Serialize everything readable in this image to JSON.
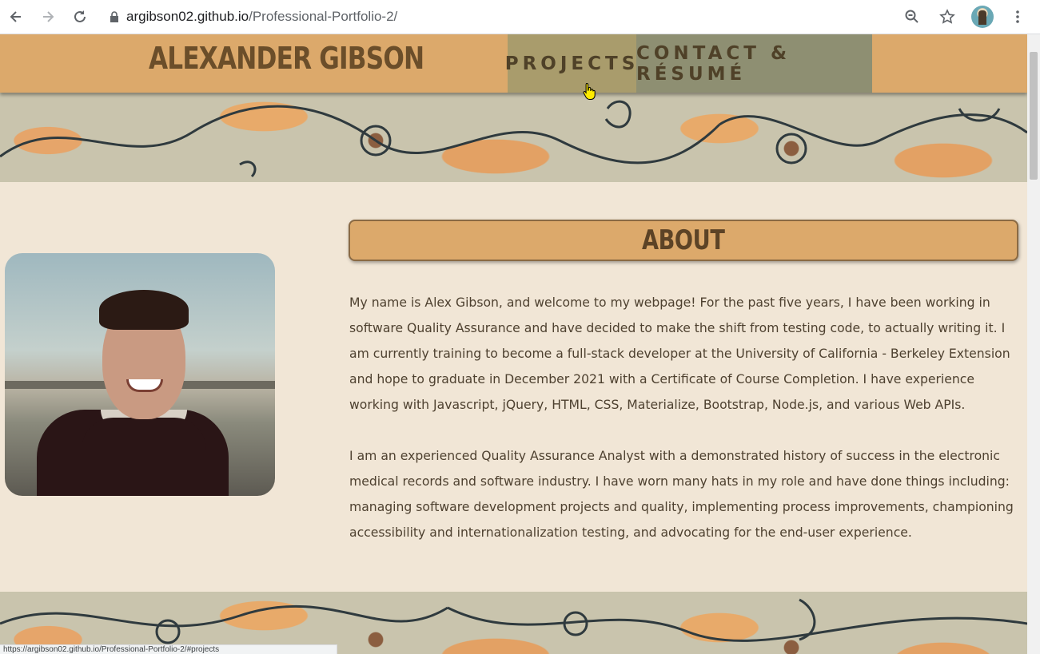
{
  "browser": {
    "url_host": "argibson02.github.io",
    "url_path": "/Professional-Portfolio-2/",
    "icons": [
      "back-arrow-icon",
      "forward-arrow-icon",
      "reload-icon",
      "lock-icon",
      "zoom-icon",
      "star-icon",
      "profile-avatar",
      "menu-dots-icon"
    ],
    "status_text": "https://argibson02.github.io/Professional-Portfolio-2/#projects"
  },
  "header": {
    "title": "ALEXANDER GIBSON",
    "nav": {
      "projects": "PROJECTS",
      "contact": "CONTACT & RÉSUMÉ"
    }
  },
  "about": {
    "heading": "ABOUT",
    "paragraphs": [
      "My name is Alex Gibson, and welcome to my webpage! For the past five years, I have been working in software Quality Assurance and have decided to make the shift from testing code, to actually writing it. I am currently training to become a full-stack developer at the University of California - Berkeley Extension and hope to graduate in December 2021 with a Certificate of Course Completion. I have experience working with Javascript, jQuery, HTML, CSS, Materialize, Bootstrap, Node.js, and various Web APIs.",
      "I am an experienced Quality Assurance Analyst with a demonstrated history of success in the electronic medical records and software industry. I have worn many hats in my role and have done things including: managing software development projects and quality, implementing process improvements, championing accessibility and internationalization testing, and advocating for the end-user experience."
    ]
  },
  "colors": {
    "header_bg": "#dca96b",
    "projects_bg": "#a99c6c",
    "contact_bg": "#8e8f72",
    "page_bg": "#f1e6d6",
    "text": "#4e4130"
  }
}
